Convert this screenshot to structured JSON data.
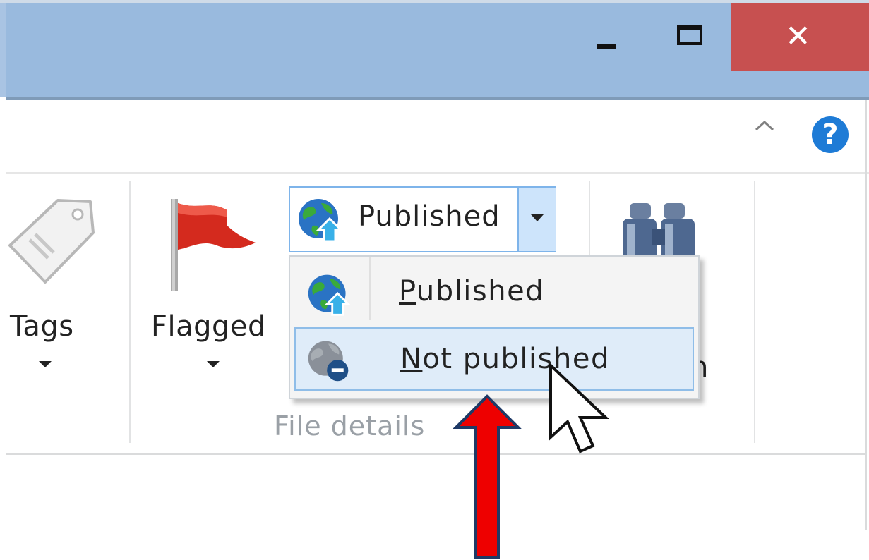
{
  "window": {
    "minimize_label": "",
    "maximize_label": "",
    "close_glyph": "✕"
  },
  "ribbon": {
    "help_glyph": "?",
    "tags": {
      "label": "Tags"
    },
    "flagged": {
      "label": "Flagged"
    },
    "publish_dropdown": {
      "selected_value": "Published",
      "icon": "globe-upload-icon"
    },
    "search": {
      "label_fragment": "h"
    },
    "group_label": "File details"
  },
  "dropdown_menu": {
    "items": [
      {
        "label_accel": "P",
        "label_rest": "ublished",
        "icon": "globe-upload-icon",
        "highlighted": false
      },
      {
        "label_accel": "N",
        "label_rest": "ot published",
        "icon": "globe-remove-icon",
        "highlighted": true
      }
    ]
  },
  "colors": {
    "titlebar": "#99bade",
    "close_button": "#c75050",
    "highlight": "#dfecf9",
    "annotation_arrow": "#ee0000"
  }
}
